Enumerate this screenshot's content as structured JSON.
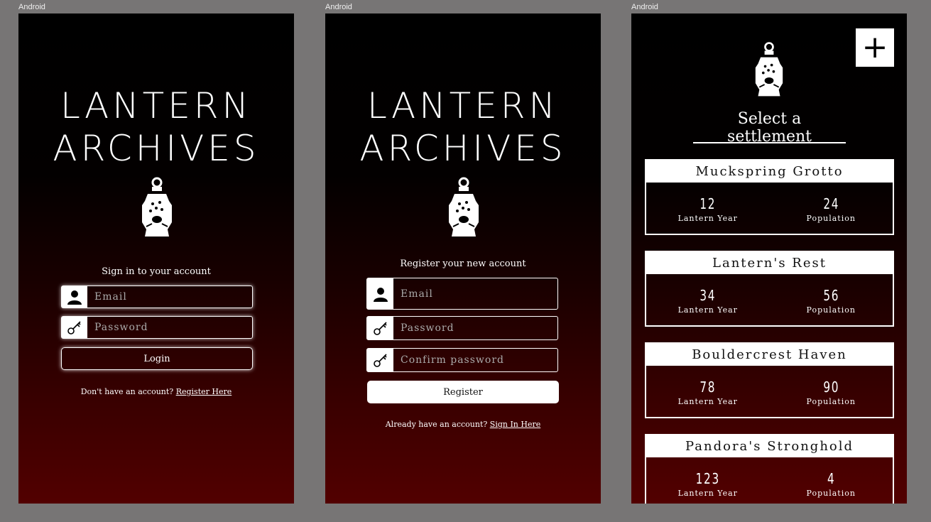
{
  "frames": [
    "Android",
    "Android",
    "Android"
  ],
  "brand": {
    "line1": "LANTERN",
    "line2": "ARCHIVES"
  },
  "login": {
    "prompt": "Sign in to your account",
    "email_placeholder": "Email",
    "password_placeholder": "Password",
    "button": "Login",
    "footer_text": "Don't have an account?",
    "footer_link": "Register Here",
    "icons": [
      "user-icon",
      "key-icon"
    ]
  },
  "register": {
    "prompt": "Register your new account",
    "email_placeholder": "Email",
    "password_placeholder": "Password",
    "confirm_placeholder": "Confirm password",
    "button": "Register",
    "footer_text": "Already have an account?",
    "footer_link": "Sign In Here"
  },
  "settlements": {
    "title": "Select a settlement",
    "add_label": "+",
    "year_label": "Lantern Year",
    "population_label": "Population",
    "items": [
      {
        "name": "Muckspring Grotto",
        "year": "12",
        "population": "24"
      },
      {
        "name": "Lantern's Rest",
        "year": "34",
        "population": "56"
      },
      {
        "name": "Bouldercrest Haven",
        "year": "78",
        "population": "90"
      },
      {
        "name": "Pandora's Stronghold",
        "year": "123",
        "population": "4"
      }
    ]
  },
  "colors": {
    "gradient_top": "#000000",
    "gradient_bottom": "#520000",
    "frame_bg": "#777575"
  }
}
